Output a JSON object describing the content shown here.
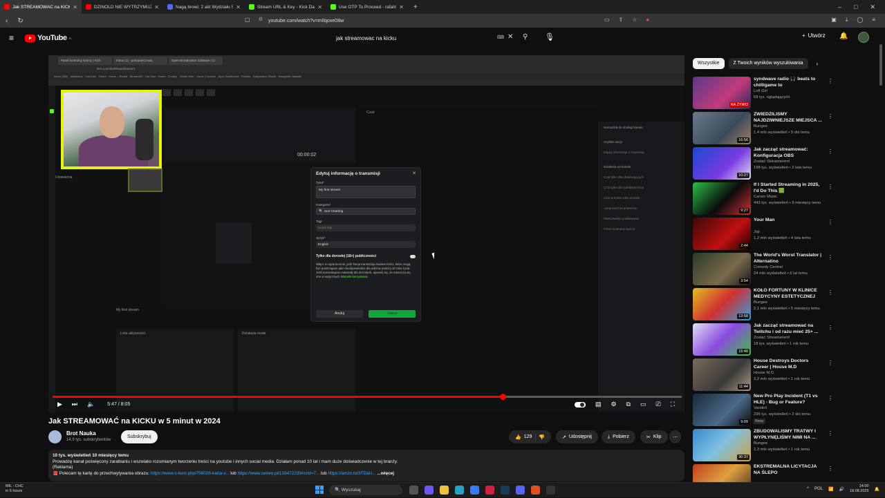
{
  "browser": {
    "tabs": [
      {
        "label": "Jak STREAMOWAĆ na KICKU w",
        "color": "#ff0000",
        "active": true
      },
      {
        "label": "DZINOLD NIE WYTRZYMUJE ZE ŚMI",
        "color": "#ff0000",
        "active": false
      },
      {
        "label": "Nagą browi: 2 akt Wydziału Specjaln",
        "color": "#4a6cf7",
        "active": false
      },
      {
        "label": "Stream URL & Key - Kick Dashboard",
        "color": "#53fc18",
        "active": false
      },
      {
        "label": "Use OTP To Proceed - rafalmiasek301",
        "color": "#53fc18",
        "active": false
      }
    ],
    "url": "youtube.com/watch?v=mIlqoxe08w",
    "window_controls": [
      "–",
      "□",
      "✕"
    ]
  },
  "youtube": {
    "logo_text": "YouTube",
    "logo_suffix": "PL",
    "search_query": "jak streamowac na kicku",
    "create_label": "Utwórz"
  },
  "inner_browser": {
    "tabs": [
      "Panel kontrolny twórcy | Kick",
      "Inbox (1) - pomarańczowa",
      "Open Broadcaster Software | O"
    ],
    "url": "kick.com/dashboard/stream",
    "bookmarks": "Inbox (250) · Mailchimp · YouTube · Twitch · Home – Reddit · StreamDB · YouTube · Home · Zmiany · Online Web · Home | Lecturio · Sync Dashboard · Fambia · Dailymotion Studio · Wszystkie zakładki"
  },
  "kick_dashboard": {
    "timer": "00:00:02",
    "chat_label": "Czat",
    "settings_label": "Ustawienia",
    "stream_title_preview": "My first stream",
    "activity_label": "Lista aktywności",
    "mod_actions_label": "Działania moda",
    "side_panel": [
      "Narzędzia do obsługi kanału",
      "Szybkie akcje",
      "Edytuj informacje o transmisji",
      "Działania na kanale",
      "Czat tylko dla obserwujących",
      "Czat tylko dla subskrybentów",
      "Czat w trybie tylko emotek",
      "Advanced bot protection",
      "Mistrzowskie podkowanie",
      "Panel kontrolny twórcy"
    ],
    "modal": {
      "title": "Edytuj informację o transmisji",
      "title_label": "Tytuł*",
      "title_value": "My first stream",
      "category_label": "Kategoria*",
      "category_value": "Just Chatting",
      "tags_label": "Tagi",
      "tags_placeholder": "Dodaj tagi",
      "language_label": "Język*",
      "language_value": "English",
      "adult_label": "Tylko dla dorosłej (18+) publiczności",
      "adult_desc": "Włącz to ograniczenie, jeśli Twoja transmisja zawiera treści, które mogą być postrzegane jako nieodpowiednie dla widzów poniżej 18 roku życia. Jeśli transmitujesz materiały dla dorosłych, upewnij się, że mieszczą się one w wytycznych",
      "terms_link": "Warunki korzystania",
      "cancel": "Anuluj",
      "save": "Zapisz"
    }
  },
  "player": {
    "time": "5:47 / 8:05",
    "progress_fraction": 0.716
  },
  "video": {
    "title": "Jak STREAMOWAĆ na KICKU w 5 minut w 2024",
    "channel": "Brot Nauka",
    "subscribers": "14,9 tys. subskrybentów",
    "subscribe_label": "Subskrybuj",
    "likes": "129",
    "share_label": "Udostępnij",
    "download_label": "Pobierz",
    "clip_label": "Klip",
    "desc_line1": "10 tys. wyświetleń  10 miesięcy temu",
    "desc_line2": "Prowadzę kanał poświęcony zarabianiu i wszelako rozumianym tworzeniu treści na youtube i innych social media. Działam ponad 10 lat i mam duże doświadczenie w tej branży.",
    "desc_line3": "(Reklama)",
    "desc_line4_prefix": "📕 Polecam tę kartę do przechwytywania obrazu: ",
    "desc_link1": "https://www.x-kom.pl/p/758026-karta-v...",
    "desc_mid1": " lub ",
    "desc_link2": "https://www.ceneo.pl/133472239#crid=7...",
    "desc_mid2": " lub ",
    "desc_link3": "https://amzn.to/3TDaU...",
    "desc_more": "...więcej"
  },
  "sidebar": {
    "chips": [
      "Wszystkie",
      "Z Twoich wyników wyszukiwania"
    ],
    "recommendations": [
      {
        "title": "syndwave radio 🎧 beats to chill/game to",
        "channel": "Lofi Girl",
        "meta": "59 tys. oglądających",
        "duration": "NA ŻYWO",
        "live": true,
        "bg": "linear-gradient(135deg,#5a3a8a,#c23a7a 60%,#2a2a5a)"
      },
      {
        "title": "ZWIEDZILIŚMY NAJDZIWNIEJSZE MIEJSCA ...",
        "channel": "Bungee",
        "meta": "1,4 mln wyświetleń • 5 dni temu",
        "duration": "16:56",
        "live": false,
        "bg": "linear-gradient(135deg,#6a7a8a,#3a4a5a 60%,#a08060)"
      },
      {
        "title": "Jak zacząć streamować: Konfiguracja OBS",
        "channel": "Zostać Streamerem!",
        "meta": "198 tys. wyświetleń • 2 lata temu",
        "duration": "10:27",
        "live": false,
        "bg": "linear-gradient(135deg,#1a4ad0,#7a3ae0 60%,#e0e0f0)"
      },
      {
        "title": "If I Started Streaming in 2025, I'd Do This 🟩",
        "channel": "Carver Music",
        "meta": "443 tys. wyświetleń • 9 miesięcy temu",
        "duration": "9:27",
        "live": false,
        "bg": "linear-gradient(135deg,#2ac04a,#0a0a0a 55%,#d03030)"
      },
      {
        "title": "Your Man",
        "channel": "Joji",
        "meta": "1,2 mln wyświetleń • 4 lata temu",
        "duration": "2:44",
        "live": false,
        "bg": "linear-gradient(135deg,#3a0a0a,#c01010 60%,#1a0000)"
      },
      {
        "title": "The World's Worst Translator | Alternatino",
        "channel": "Comedy Central",
        "meta": "24 mln wyświetleń • 6 lat temu",
        "duration": "3:54",
        "live": false,
        "bg": "linear-gradient(135deg,#2a3a2a,#7a6a4a 60%,#1a1a1a)"
      },
      {
        "title": "KOŁO FORTUNY W KLINICE MEDYCYNY ESTETYCZNEJ",
        "channel": "Bungee",
        "meta": "2,1 mln wyświetleń • 5 miesięcy temu",
        "duration": "13:58",
        "live": false,
        "bg": "linear-gradient(135deg,#e0c020,#d03030 50%,#30a0e0)"
      },
      {
        "title": "Jak zacząć streamować na Twitchu i od razu mieć 25+ ...",
        "channel": "Zostać Streamerem!",
        "meta": "18 tys. wyświetleń • 1 rok temu",
        "duration": "15:40",
        "live": false,
        "bg": "linear-gradient(135deg,#e0e0f0,#8a4ae0 50%,#40c040)"
      },
      {
        "title": "House Destroys Doctors Career | House M.D",
        "channel": "House M.D.",
        "meta": "3,2 mln wyświetleń • 1 rok temu",
        "duration": "11:44",
        "live": false,
        "bg": "linear-gradient(135deg,#7a6a5a,#3a3a3a 60%,#b09a80)"
      },
      {
        "title": "New Pro Play Incident (T1 vs HLE) - Bug or Feature?",
        "channel": "Vandiril",
        "meta": "296 tys. wyświetleń • 2 dni temu",
        "duration": "9:09",
        "live": false,
        "badge": "Nowy",
        "bg": "linear-gradient(135deg,#1a2a3a,#4a6a8a 60%,#0a0a0a)"
      },
      {
        "title": "ZBUDOWALIŚMY TRATWY I WYPŁYNĘLIŚMY NIMI NA ...",
        "channel": "Bungee",
        "meta": "2,3 mln wyświetleń • 1 rok temu",
        "duration": "30:37",
        "live": false,
        "bg": "linear-gradient(135deg,#3a8ad0,#80c0e0 50%,#d0a040)"
      },
      {
        "title": "EKSTREMALNA LICYTACJA NA ŚLEPO",
        "channel": "",
        "meta": "",
        "duration": "",
        "live": false,
        "bg": "linear-gradient(135deg,#c04020,#e0a040 50%,#3a2a1a)"
      }
    ]
  },
  "taskbar": {
    "weather_temp": "MIL - CHC",
    "weather_sub": "in 6 hours",
    "search_label": "Wyszukaj",
    "lang": "POL",
    "time": "14:00",
    "date": "18.08.2025"
  }
}
